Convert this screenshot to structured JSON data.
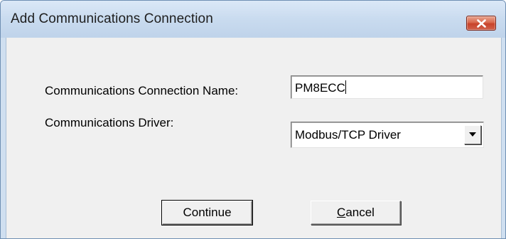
{
  "window": {
    "title": "Add Communications Connection"
  },
  "form": {
    "name_label": "Communications Connection Name:",
    "name_value": "PM8ECC",
    "driver_label": "Communications Driver:",
    "driver_selected": "Modbus/TCP Driver"
  },
  "buttons": {
    "continue_label": "Continue",
    "cancel_first_letter": "C",
    "cancel_rest": "ancel"
  },
  "colors": {
    "title_bar": "#c9dbef",
    "close_button": "#c8432a",
    "client_background": "#f0f0f0"
  },
  "icons": {
    "close": "close-x-icon",
    "dropdown": "chevron-down-icon"
  }
}
